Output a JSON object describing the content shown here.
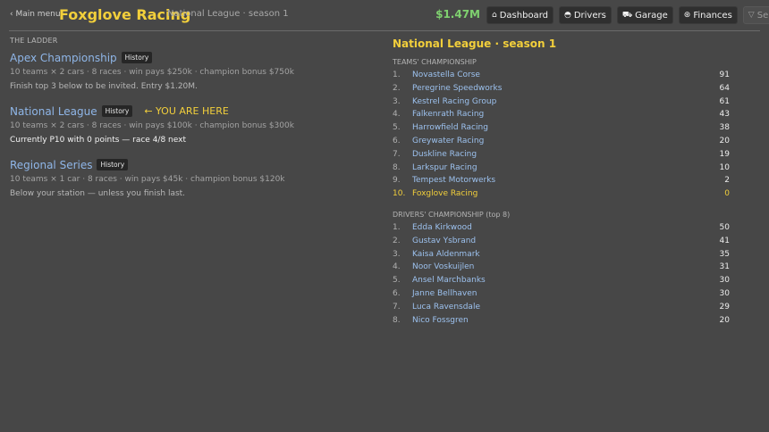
{
  "header": {
    "main_menu": "‹ Main menu",
    "team_name": "Foxglove Racing",
    "season": "National League · season 1",
    "money": "$1.47M",
    "nav": [
      {
        "label": "Dashboard",
        "icon": "home-icon",
        "disabled": false
      },
      {
        "label": "Drivers",
        "icon": "helmet-icon",
        "disabled": false
      },
      {
        "label": "Garage",
        "icon": "car-icon",
        "disabled": false
      },
      {
        "label": "Finances",
        "icon": "coin-icon",
        "disabled": false
      },
      {
        "label": "Series",
        "icon": "trophy-icon",
        "disabled": true
      }
    ]
  },
  "ladder": {
    "title": "THE LADDER",
    "you_are_here": "← YOU ARE HERE",
    "leagues": [
      {
        "name": "Apex Championship",
        "history": "History",
        "info": "10 teams × 2 cars · 8 races · win pays $250k · champion bonus $750k",
        "note": "Finish top 3 below to be invited. Entry $1.20M."
      },
      {
        "name": "National League",
        "history": "History",
        "info": "10 teams × 2 cars · 8 races · win pays $100k · champion bonus $300k",
        "note": "Currently P10 with 0 points — race 4/8 next"
      },
      {
        "name": "Regional Series",
        "history": "History",
        "info": "10 teams × 1 car · 8 races · win pays $45k · champion bonus $120k",
        "note": "Below your station — unless you finish last."
      }
    ]
  },
  "standings": {
    "title": "National League · season 1",
    "teams_title": "TEAMS' CHAMPIONSHIP",
    "teams": [
      {
        "pos": "1.",
        "name": "Novastella Corse",
        "pts": "91"
      },
      {
        "pos": "2.",
        "name": "Peregrine Speedworks",
        "pts": "64"
      },
      {
        "pos": "3.",
        "name": "Kestrel Racing Group",
        "pts": "61"
      },
      {
        "pos": "4.",
        "name": "Falkenrath Racing",
        "pts": "43"
      },
      {
        "pos": "5.",
        "name": "Harrowfield Racing",
        "pts": "38"
      },
      {
        "pos": "6.",
        "name": "Greywater Racing",
        "pts": "20"
      },
      {
        "pos": "7.",
        "name": "Duskline Racing",
        "pts": "19"
      },
      {
        "pos": "8.",
        "name": "Larkspur Racing",
        "pts": "10"
      },
      {
        "pos": "9.",
        "name": "Tempest Motorwerks",
        "pts": "2"
      },
      {
        "pos": "10.",
        "name": "Foxglove Racing",
        "pts": "0"
      }
    ],
    "drivers_title": "DRIVERS' CHAMPIONSHIP (top 8)",
    "drivers": [
      {
        "pos": "1.",
        "name": "Edda Kirkwood",
        "pts": "50"
      },
      {
        "pos": "2.",
        "name": "Gustav Ysbrand",
        "pts": "41"
      },
      {
        "pos": "3.",
        "name": "Kaisa Aldenmark",
        "pts": "35"
      },
      {
        "pos": "4.",
        "name": "Noor Voskuijlen",
        "pts": "31"
      },
      {
        "pos": "5.",
        "name": "Ansel Marchbanks",
        "pts": "30"
      },
      {
        "pos": "6.",
        "name": "Janne Bellhaven",
        "pts": "30"
      },
      {
        "pos": "7.",
        "name": "Luca Ravensdale",
        "pts": "29"
      },
      {
        "pos": "8.",
        "name": "Nico Fossgren",
        "pts": "20"
      }
    ]
  },
  "colors": {
    "background": "#474747",
    "accent": "#f2cf3b",
    "money": "#7fd06f",
    "link": "#8fb6e8"
  }
}
